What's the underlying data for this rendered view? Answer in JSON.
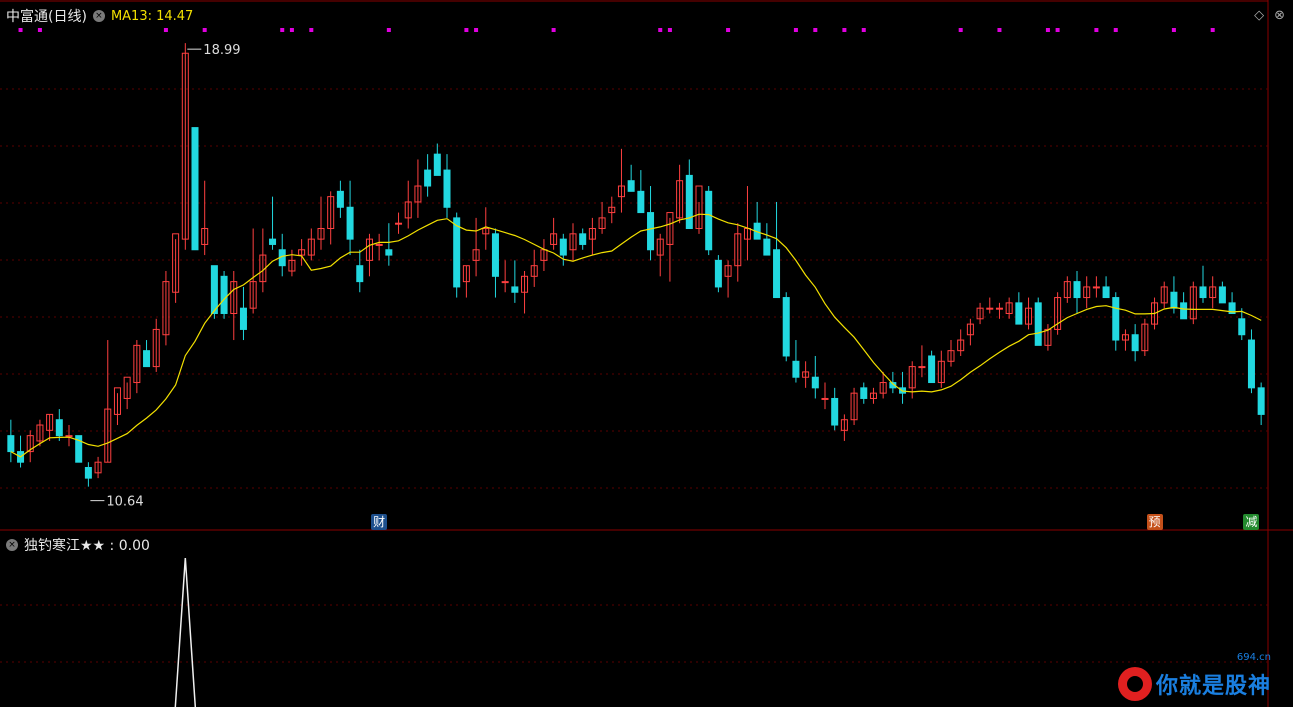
{
  "header": {
    "stock_name": "中富通(日线)",
    "ma_label": "MA13: 14.47",
    "expand_glyph": "◇",
    "circle_glyph": "×"
  },
  "annotations": {
    "high_label": "18.99",
    "low_label": "10.64"
  },
  "flags": [
    {
      "label": "财",
      "color": "#1d4f8c"
    },
    {
      "label": "预",
      "color": "#c4501a"
    },
    {
      "label": "减",
      "color": "#238a2e"
    }
  ],
  "indicator": {
    "label": "独钓寒江★★ : 0.00"
  },
  "watermark": {
    "text": "你就是股神",
    "url": "694.cn"
  },
  "colors": {
    "up": "#ff4040",
    "down": "#22d8e0",
    "ma": "#f2e000",
    "grid": "#5a0000",
    "marker": "#e000e0"
  },
  "chart_data": {
    "type": "candlestick",
    "ma_period": 13,
    "high": 18.99,
    "low": 10.64,
    "ohlc": [
      [
        11.6,
        11.9,
        11.1,
        11.3
      ],
      [
        11.3,
        11.6,
        11.0,
        11.1
      ],
      [
        11.3,
        11.7,
        11.1,
        11.6
      ],
      [
        11.5,
        11.9,
        11.4,
        11.8
      ],
      [
        11.7,
        12.0,
        11.5,
        12.0
      ],
      [
        11.9,
        12.1,
        11.5,
        11.6
      ],
      [
        11.6,
        11.8,
        11.4,
        11.6
      ],
      [
        11.6,
        11.6,
        11.1,
        11.1
      ],
      [
        11.0,
        11.1,
        10.64,
        10.8
      ],
      [
        10.9,
        11.2,
        10.8,
        11.1
      ],
      [
        11.1,
        13.4,
        11.1,
        12.1
      ],
      [
        12.0,
        12.4,
        11.8,
        12.5
      ],
      [
        12.3,
        12.6,
        12.1,
        12.7
      ],
      [
        12.6,
        13.4,
        12.4,
        13.3
      ],
      [
        13.2,
        13.4,
        12.9,
        12.9
      ],
      [
        12.9,
        13.8,
        12.8,
        13.6
      ],
      [
        13.5,
        14.7,
        13.3,
        14.5
      ],
      [
        14.3,
        15.3,
        14.1,
        15.4
      ],
      [
        15.3,
        18.99,
        15.1,
        18.8
      ],
      [
        17.4,
        17.4,
        15.1,
        15.1
      ],
      [
        15.2,
        16.4,
        15.0,
        15.5
      ],
      [
        14.8,
        14.8,
        13.8,
        13.9
      ],
      [
        14.6,
        14.7,
        13.8,
        13.9
      ],
      [
        13.9,
        14.7,
        13.4,
        14.5
      ],
      [
        14.0,
        14.4,
        13.4,
        13.6
      ],
      [
        14.0,
        15.5,
        13.9,
        14.5
      ],
      [
        14.5,
        15.5,
        14.3,
        15.0
      ],
      [
        15.3,
        16.1,
        15.1,
        15.2
      ],
      [
        15.1,
        15.4,
        14.6,
        14.8
      ],
      [
        14.7,
        15.1,
        14.6,
        14.9
      ],
      [
        15.0,
        15.3,
        14.8,
        15.1
      ],
      [
        15.0,
        15.5,
        14.9,
        15.3
      ],
      [
        15.3,
        16.1,
        15.1,
        15.5
      ],
      [
        15.5,
        16.2,
        15.2,
        16.1
      ],
      [
        16.2,
        16.4,
        15.7,
        15.9
      ],
      [
        15.9,
        16.4,
        15.0,
        15.3
      ],
      [
        14.8,
        15.1,
        14.3,
        14.5
      ],
      [
        14.9,
        15.4,
        14.6,
        15.3
      ],
      [
        15.2,
        15.4,
        14.9,
        15.2
      ],
      [
        15.1,
        15.6,
        14.8,
        15.0
      ],
      [
        15.6,
        15.8,
        15.4,
        15.6
      ],
      [
        15.7,
        16.4,
        15.5,
        16.0
      ],
      [
        16.0,
        16.8,
        15.7,
        16.3
      ],
      [
        16.6,
        16.9,
        16.1,
        16.3
      ],
      [
        16.9,
        17.1,
        16.5,
        16.5
      ],
      [
        16.6,
        16.9,
        15.7,
        15.9
      ],
      [
        15.7,
        15.8,
        14.2,
        14.4
      ],
      [
        14.5,
        14.8,
        14.2,
        14.8
      ],
      [
        14.9,
        15.7,
        14.6,
        15.1
      ],
      [
        15.4,
        15.9,
        15.1,
        15.5
      ],
      [
        15.4,
        15.5,
        14.2,
        14.6
      ],
      [
        14.5,
        14.9,
        14.3,
        14.5
      ],
      [
        14.4,
        14.9,
        14.1,
        14.3
      ],
      [
        14.3,
        14.7,
        13.9,
        14.6
      ],
      [
        14.6,
        15.1,
        14.4,
        14.8
      ],
      [
        14.9,
        15.3,
        14.7,
        15.1
      ],
      [
        15.2,
        15.7,
        15.1,
        15.4
      ],
      [
        15.3,
        15.4,
        14.8,
        15.0
      ],
      [
        15.1,
        15.6,
        14.9,
        15.4
      ],
      [
        15.4,
        15.5,
        15.1,
        15.2
      ],
      [
        15.3,
        15.7,
        15.0,
        15.5
      ],
      [
        15.5,
        16.0,
        15.4,
        15.7
      ],
      [
        15.8,
        16.1,
        15.6,
        15.9
      ],
      [
        16.1,
        17.0,
        15.8,
        16.3
      ],
      [
        16.4,
        16.7,
        16.2,
        16.2
      ],
      [
        16.2,
        16.6,
        15.9,
        15.8
      ],
      [
        15.8,
        16.3,
        14.9,
        15.1
      ],
      [
        15.0,
        15.4,
        14.6,
        15.3
      ],
      [
        15.2,
        15.7,
        14.5,
        15.8
      ],
      [
        15.7,
        16.7,
        15.6,
        16.4
      ],
      [
        16.5,
        16.8,
        15.6,
        15.5
      ],
      [
        15.5,
        16.0,
        15.4,
        16.3
      ],
      [
        16.2,
        16.3,
        15.0,
        15.1
      ],
      [
        14.9,
        15.0,
        14.3,
        14.4
      ],
      [
        14.6,
        14.9,
        14.2,
        14.8
      ],
      [
        14.8,
        15.6,
        14.5,
        15.4
      ],
      [
        15.3,
        16.3,
        14.9,
        15.5
      ],
      [
        15.6,
        16.0,
        15.4,
        15.3
      ],
      [
        15.3,
        15.6,
        15.0,
        15.0
      ],
      [
        15.1,
        16.0,
        14.2,
        14.2
      ],
      [
        14.2,
        14.3,
        13.0,
        13.1
      ],
      [
        13.0,
        13.4,
        12.6,
        12.7
      ],
      [
        12.7,
        13.0,
        12.5,
        12.8
      ],
      [
        12.7,
        13.1,
        12.3,
        12.5
      ],
      [
        12.3,
        12.6,
        12.1,
        12.3
      ],
      [
        12.3,
        12.5,
        11.7,
        11.8
      ],
      [
        11.7,
        12.0,
        11.5,
        11.9
      ],
      [
        11.9,
        12.5,
        11.8,
        12.4
      ],
      [
        12.5,
        12.6,
        12.2,
        12.3
      ],
      [
        12.3,
        12.5,
        12.2,
        12.4
      ],
      [
        12.4,
        12.8,
        12.3,
        12.6
      ],
      [
        12.6,
        12.8,
        12.4,
        12.5
      ],
      [
        12.5,
        12.8,
        12.2,
        12.4
      ],
      [
        12.5,
        13.0,
        12.3,
        12.9
      ],
      [
        12.9,
        13.3,
        12.7,
        12.9
      ],
      [
        13.1,
        13.2,
        12.6,
        12.6
      ],
      [
        12.6,
        13.2,
        12.5,
        13.0
      ],
      [
        13.0,
        13.4,
        12.9,
        13.2
      ],
      [
        13.2,
        13.6,
        13.1,
        13.4
      ],
      [
        13.5,
        13.8,
        13.3,
        13.7
      ],
      [
        13.8,
        14.1,
        13.7,
        14.0
      ],
      [
        14.0,
        14.2,
        13.9,
        14.0
      ],
      [
        14.0,
        14.1,
        13.8,
        14.0
      ],
      [
        13.9,
        14.2,
        13.8,
        14.1
      ],
      [
        14.1,
        14.3,
        13.7,
        13.7
      ],
      [
        13.7,
        14.2,
        13.6,
        14.0
      ],
      [
        14.1,
        14.2,
        13.3,
        13.3
      ],
      [
        13.3,
        13.7,
        13.2,
        13.6
      ],
      [
        13.6,
        14.3,
        13.5,
        14.2
      ],
      [
        14.2,
        14.6,
        14.1,
        14.5
      ],
      [
        14.5,
        14.7,
        13.9,
        14.2
      ],
      [
        14.2,
        14.6,
        14.0,
        14.4
      ],
      [
        14.4,
        14.6,
        14.2,
        14.4
      ],
      [
        14.4,
        14.6,
        14.2,
        14.2
      ],
      [
        14.2,
        14.3,
        13.2,
        13.4
      ],
      [
        13.4,
        13.6,
        13.2,
        13.5
      ],
      [
        13.5,
        13.7,
        13.0,
        13.2
      ],
      [
        13.2,
        13.8,
        13.1,
        13.7
      ],
      [
        13.7,
        14.2,
        13.6,
        14.1
      ],
      [
        14.1,
        14.5,
        14.0,
        14.4
      ],
      [
        14.3,
        14.6,
        13.9,
        14.0
      ],
      [
        14.1,
        14.3,
        13.8,
        13.8
      ],
      [
        13.8,
        14.5,
        13.7,
        14.4
      ],
      [
        14.4,
        14.8,
        14.1,
        14.2
      ],
      [
        14.2,
        14.6,
        14.0,
        14.4
      ],
      [
        14.4,
        14.5,
        14.1,
        14.1
      ],
      [
        14.1,
        14.3,
        13.9,
        13.9
      ],
      [
        13.8,
        14.0,
        13.4,
        13.5
      ],
      [
        13.4,
        13.6,
        12.4,
        12.5
      ],
      [
        12.5,
        12.6,
        11.8,
        12.0
      ]
    ],
    "indicator_values": [
      0,
      0,
      0,
      0,
      0,
      0,
      0,
      0,
      0,
      0,
      0,
      0,
      0,
      0,
      0,
      0,
      0,
      0,
      1,
      0
    ]
  }
}
